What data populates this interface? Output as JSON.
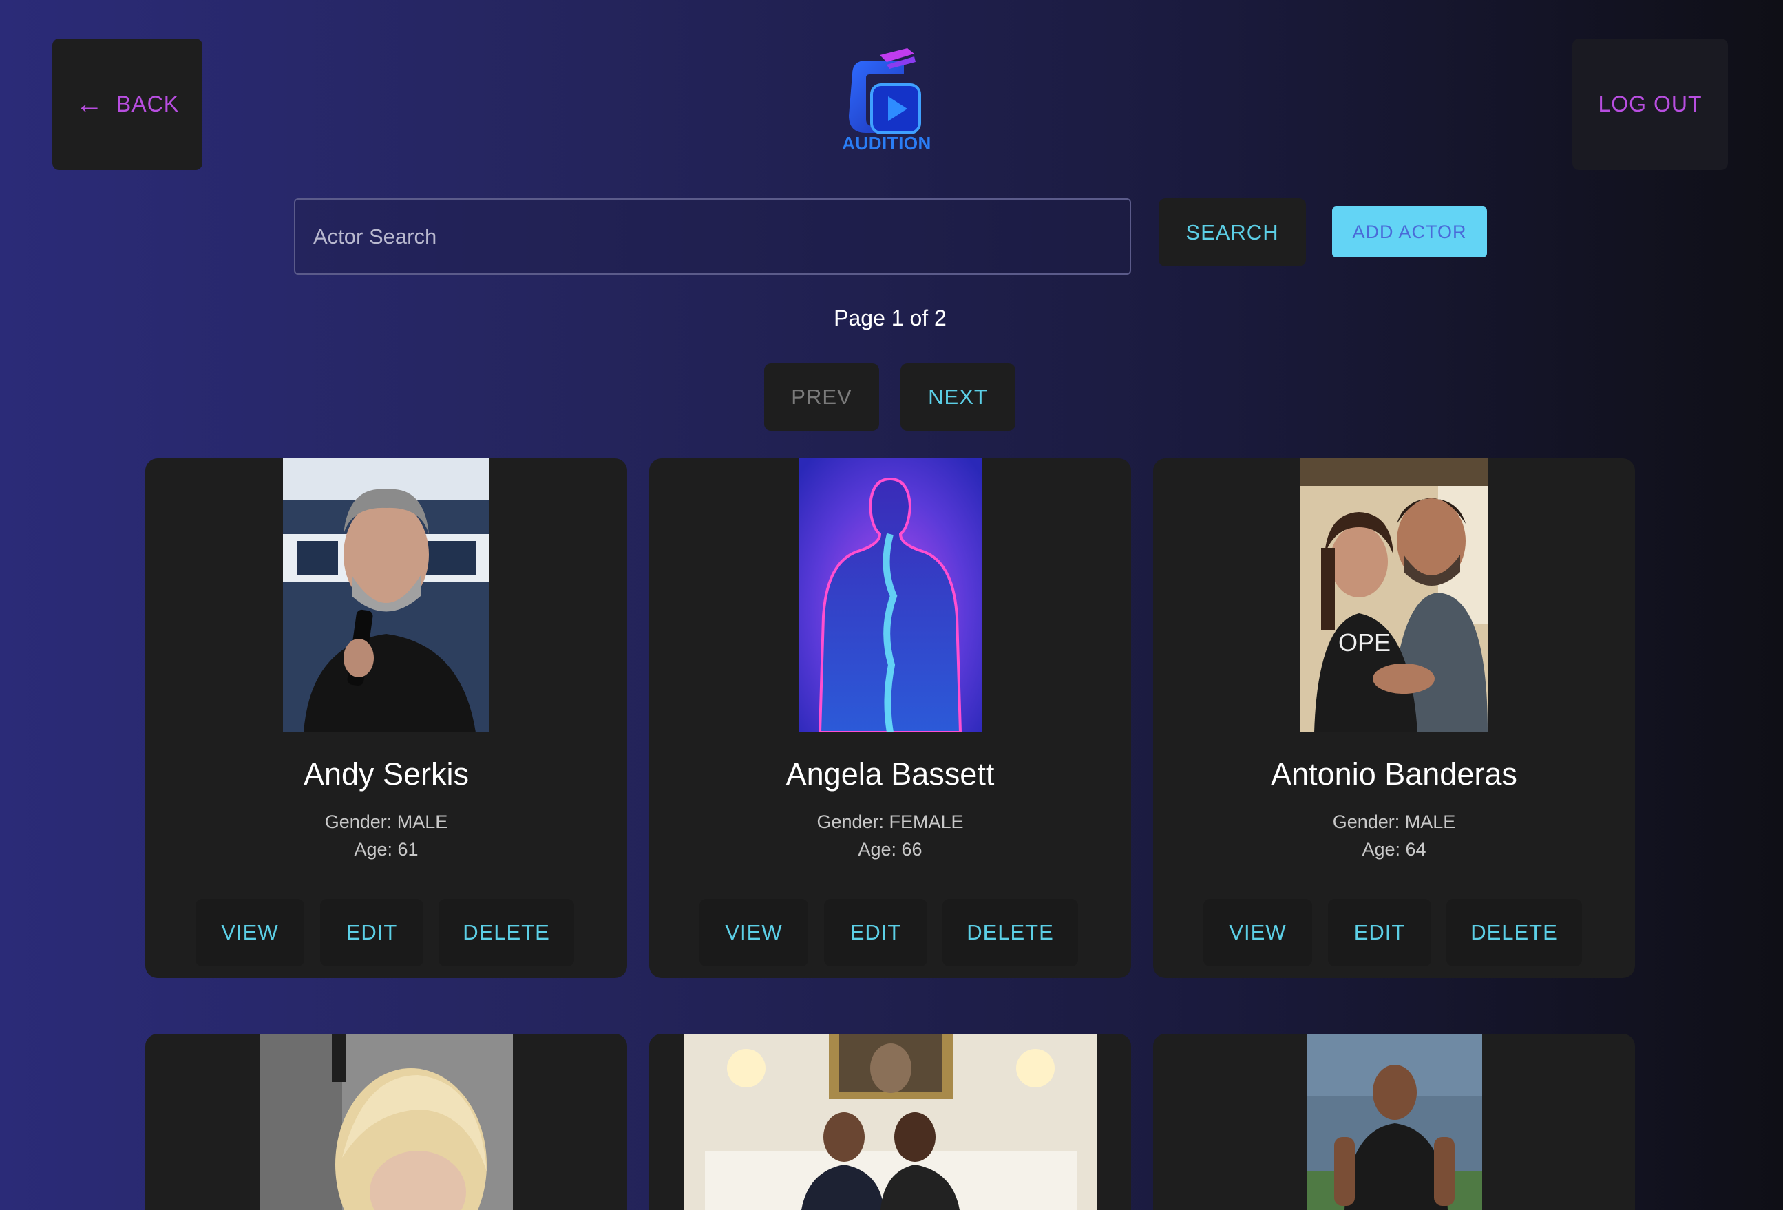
{
  "header": {
    "back_label": "BACK",
    "logout_label": "LOG OUT",
    "logo_text": "AUDITION"
  },
  "search": {
    "placeholder": "Actor Search",
    "search_label": "SEARCH",
    "add_label": "ADD ACTOR"
  },
  "pagination": {
    "page_text": "Page 1 of 2",
    "prev_label": "PREV",
    "next_label": "NEXT"
  },
  "actors": [
    {
      "name": "Andy Serkis",
      "gender": "Gender: MALE",
      "age": "Age: 61"
    },
    {
      "name": "Angela Bassett",
      "gender": "Gender: FEMALE",
      "age": "Age: 66"
    },
    {
      "name": "Antonio Banderas",
      "gender": "Gender: MALE",
      "age": "Age: 64"
    }
  ],
  "card_actions": {
    "view": "VIEW",
    "edit": "EDIT",
    "delete": "DELETE"
  },
  "colors": {
    "accent_purple": "#b84ee0",
    "accent_cyan": "#5ccfe6",
    "card_bg": "#1e1e1e",
    "add_button_bg": "#63d4f5"
  }
}
